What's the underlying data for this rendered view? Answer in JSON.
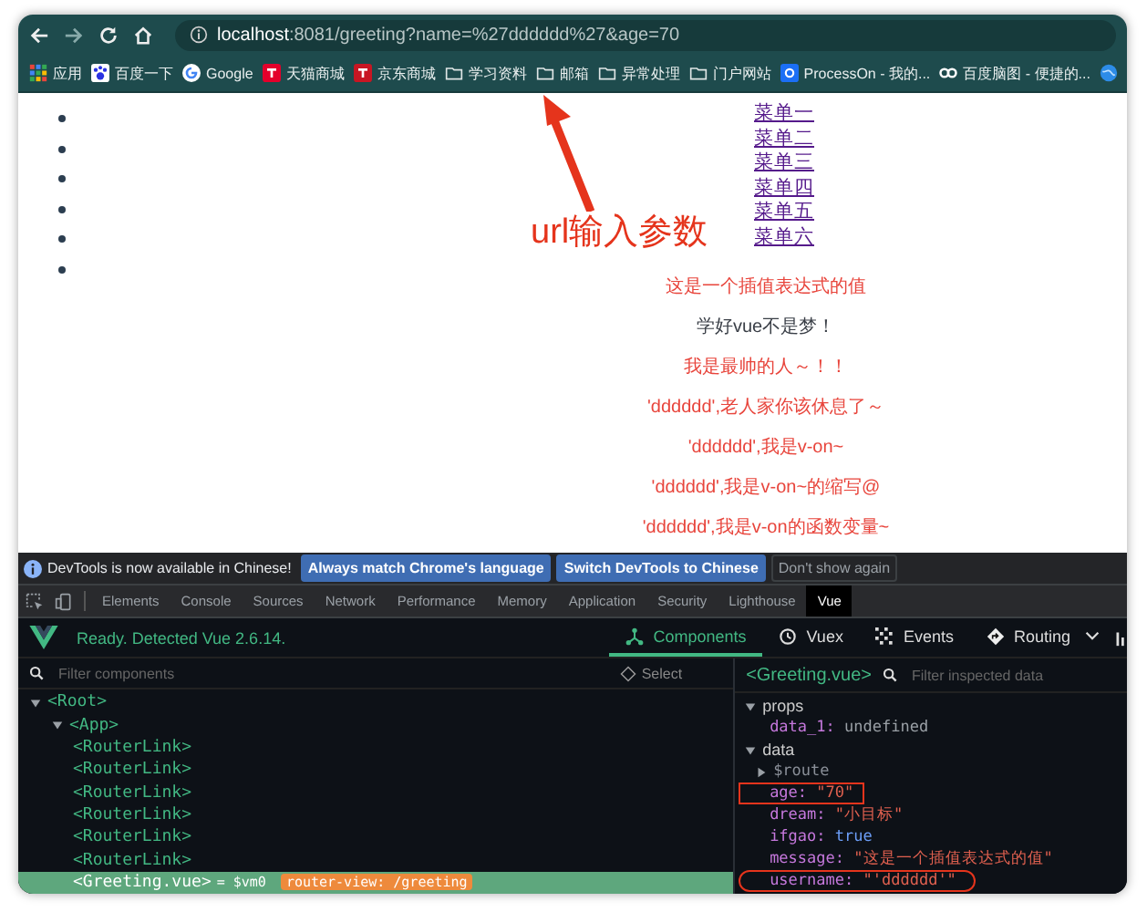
{
  "browser": {
    "url_host": "localhost",
    "url_rest": ":8081/greeting?name=%27dddddd%27&age=70",
    "bookmarks": [
      {
        "label": "应用",
        "kind": "apps"
      },
      {
        "label": "百度一下",
        "kind": "baidu"
      },
      {
        "label": "Google",
        "kind": "google"
      },
      {
        "label": "天猫商城",
        "kind": "tmall"
      },
      {
        "label": "京东商城",
        "kind": "jd"
      },
      {
        "label": "学习资料",
        "kind": "folder"
      },
      {
        "label": "邮箱",
        "kind": "folder"
      },
      {
        "label": "异常处理",
        "kind": "folder"
      },
      {
        "label": "门户网站",
        "kind": "folder"
      },
      {
        "label": "ProcessOn - 我的...",
        "kind": "processon"
      },
      {
        "label": "百度脑图 - 便捷的...",
        "kind": "mind"
      },
      {
        "kind": "globe"
      }
    ]
  },
  "page": {
    "bullets": [
      {
        "kind": "bullet"
      },
      {
        "kind": "bullet"
      },
      {
        "kind": "bullet"
      },
      {
        "kind": "bullet"
      },
      {
        "kind": "bullet"
      },
      {
        "kind": "bullet"
      }
    ],
    "links": [
      "菜单一",
      "菜单二",
      "菜单三",
      "菜单四",
      "菜单五",
      "菜单六"
    ],
    "messages": [
      {
        "text": "这是一个插值表达式的值",
        "color": "#e8453c"
      },
      {
        "text": "学好vue不是梦！",
        "color": "#3a3f47"
      },
      {
        "text": "我是最帅的人～！！",
        "color": "#e8453c"
      },
      {
        "text": "'dddddd',老人家你该休息了～",
        "color": "#e8453c"
      },
      {
        "text": "'dddddd',我是v-on~",
        "color": "#e8453c"
      },
      {
        "text": "'dddddd',我是v-on~的缩写@",
        "color": "#e8453c"
      },
      {
        "text": "'dddddd',我是v-on的函数变量~",
        "color": "#e8453c"
      }
    ]
  },
  "annotation": {
    "label": "url输入参数"
  },
  "devtools": {
    "notice": "DevTools is now available in Chinese!",
    "notice_buttons": [
      {
        "label": "Always match Chrome's language",
        "kind": "primary"
      },
      {
        "label": "Switch DevTools to Chinese",
        "kind": "primary"
      },
      {
        "label": "Don't show again",
        "kind": "plain"
      }
    ],
    "tabs": [
      {
        "label": "Elements",
        "selected": false
      },
      {
        "label": "Console",
        "selected": false
      },
      {
        "label": "Sources",
        "selected": false
      },
      {
        "label": "Network",
        "selected": false
      },
      {
        "label": "Performance",
        "selected": false
      },
      {
        "label": "Memory",
        "selected": false
      },
      {
        "label": "Application",
        "selected": false
      },
      {
        "label": "Security",
        "selected": false
      },
      {
        "label": "Lighthouse",
        "selected": false
      },
      {
        "label": "Vue",
        "selected": true
      }
    ],
    "vue": {
      "status": "Ready. Detected Vue 2.6.14.",
      "nav": [
        {
          "label": "Components",
          "kind": "components",
          "selected": true
        },
        {
          "label": "Vuex",
          "kind": "vuex",
          "selected": false
        },
        {
          "label": "Events",
          "kind": "events",
          "selected": false
        },
        {
          "label": "Routing",
          "kind": "routing",
          "selected": false
        }
      ],
      "filter_placeholder": "Filter components",
      "select_label": "Select",
      "tree": [
        {
          "name": "<Root>",
          "expanded": true,
          "selected": false,
          "children": [
            {
              "name": "<App>",
              "expanded": true,
              "selected": false,
              "children": [
                {
                  "name": "<RouterLink>",
                  "selected": false
                },
                {
                  "name": "<RouterLink>",
                  "selected": false
                },
                {
                  "name": "<RouterLink>",
                  "selected": false
                },
                {
                  "name": "<RouterLink>",
                  "selected": false
                },
                {
                  "name": "<RouterLink>",
                  "selected": false
                },
                {
                  "name": "<RouterLink>",
                  "selected": false
                },
                {
                  "name": "<Greeting.vue>",
                  "selected": true,
                  "ref": "= $vm0",
                  "badge": "router-view: /greeting"
                }
              ]
            }
          ]
        }
      ],
      "inspector": {
        "title": "<Greeting.vue>",
        "filter_placeholder": "Filter inspected data",
        "sections": [
          {
            "name": "props",
            "expanded": true,
            "items": [
              {
                "key": "data_1:",
                "value": "undefined",
                "kind": "undefined"
              }
            ]
          },
          {
            "name": "data",
            "expanded": true,
            "items": [
              {
                "key": "$route",
                "kind": "object",
                "expanded": false
              },
              {
                "key": "age:",
                "value": "\"70\"",
                "kind": "string",
                "boxed": true
              },
              {
                "key": "dream:",
                "value": "\"小目标\"",
                "kind": "string"
              },
              {
                "key": "ifgao:",
                "value": "true",
                "kind": "boolean"
              },
              {
                "key": "message:",
                "value": "\"这是一个插值表达式的值\"",
                "kind": "string"
              },
              {
                "key": "username:",
                "value": "\"'dddddd'\"",
                "kind": "string",
                "circled": true
              }
            ]
          }
        ]
      }
    }
  }
}
